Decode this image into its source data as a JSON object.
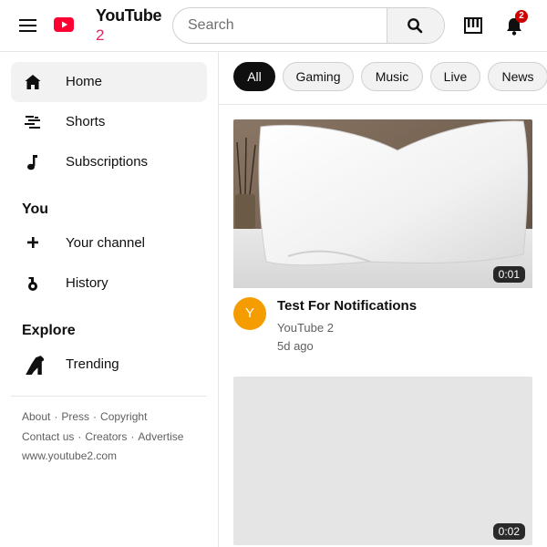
{
  "header": {
    "brand_name": "YouTube",
    "brand_suffix": "2",
    "search_placeholder": "Search",
    "search_value": "",
    "notification_count": "2"
  },
  "sidebar": {
    "items": [
      {
        "label": "Home",
        "icon": "home-icon",
        "active": true
      },
      {
        "label": "Shorts",
        "icon": "shorts-icon"
      },
      {
        "label": "Subscriptions",
        "icon": "music-note-icon"
      }
    ],
    "you_title": "You",
    "you_items": [
      {
        "label": "Your channel",
        "icon": "plus-icon"
      },
      {
        "label": "History",
        "icon": "history-icon"
      }
    ],
    "explore_title": "Explore",
    "explore_items": [
      {
        "label": "Trending",
        "icon": "trending-icon"
      }
    ],
    "footer": {
      "line1": [
        "About",
        "Press",
        "Copyright"
      ],
      "line2": [
        "Contact us",
        "Creators",
        "Advertise"
      ],
      "line3": "www.youtube2.com"
    }
  },
  "chips": [
    "All",
    "Gaming",
    "Music",
    "Live",
    "News"
  ],
  "videos": [
    {
      "title": "Test For Notifications",
      "channel": "YouTube 2",
      "age": "5d ago",
      "duration": "0:01",
      "avatar_letter": "Y"
    },
    {
      "duration": "0:02"
    }
  ],
  "colors": {
    "brand_red": "#ff0033",
    "suffix_pink": "#e0245e",
    "avatar_orange": "#f59c00",
    "badge_red": "#cc0000"
  }
}
